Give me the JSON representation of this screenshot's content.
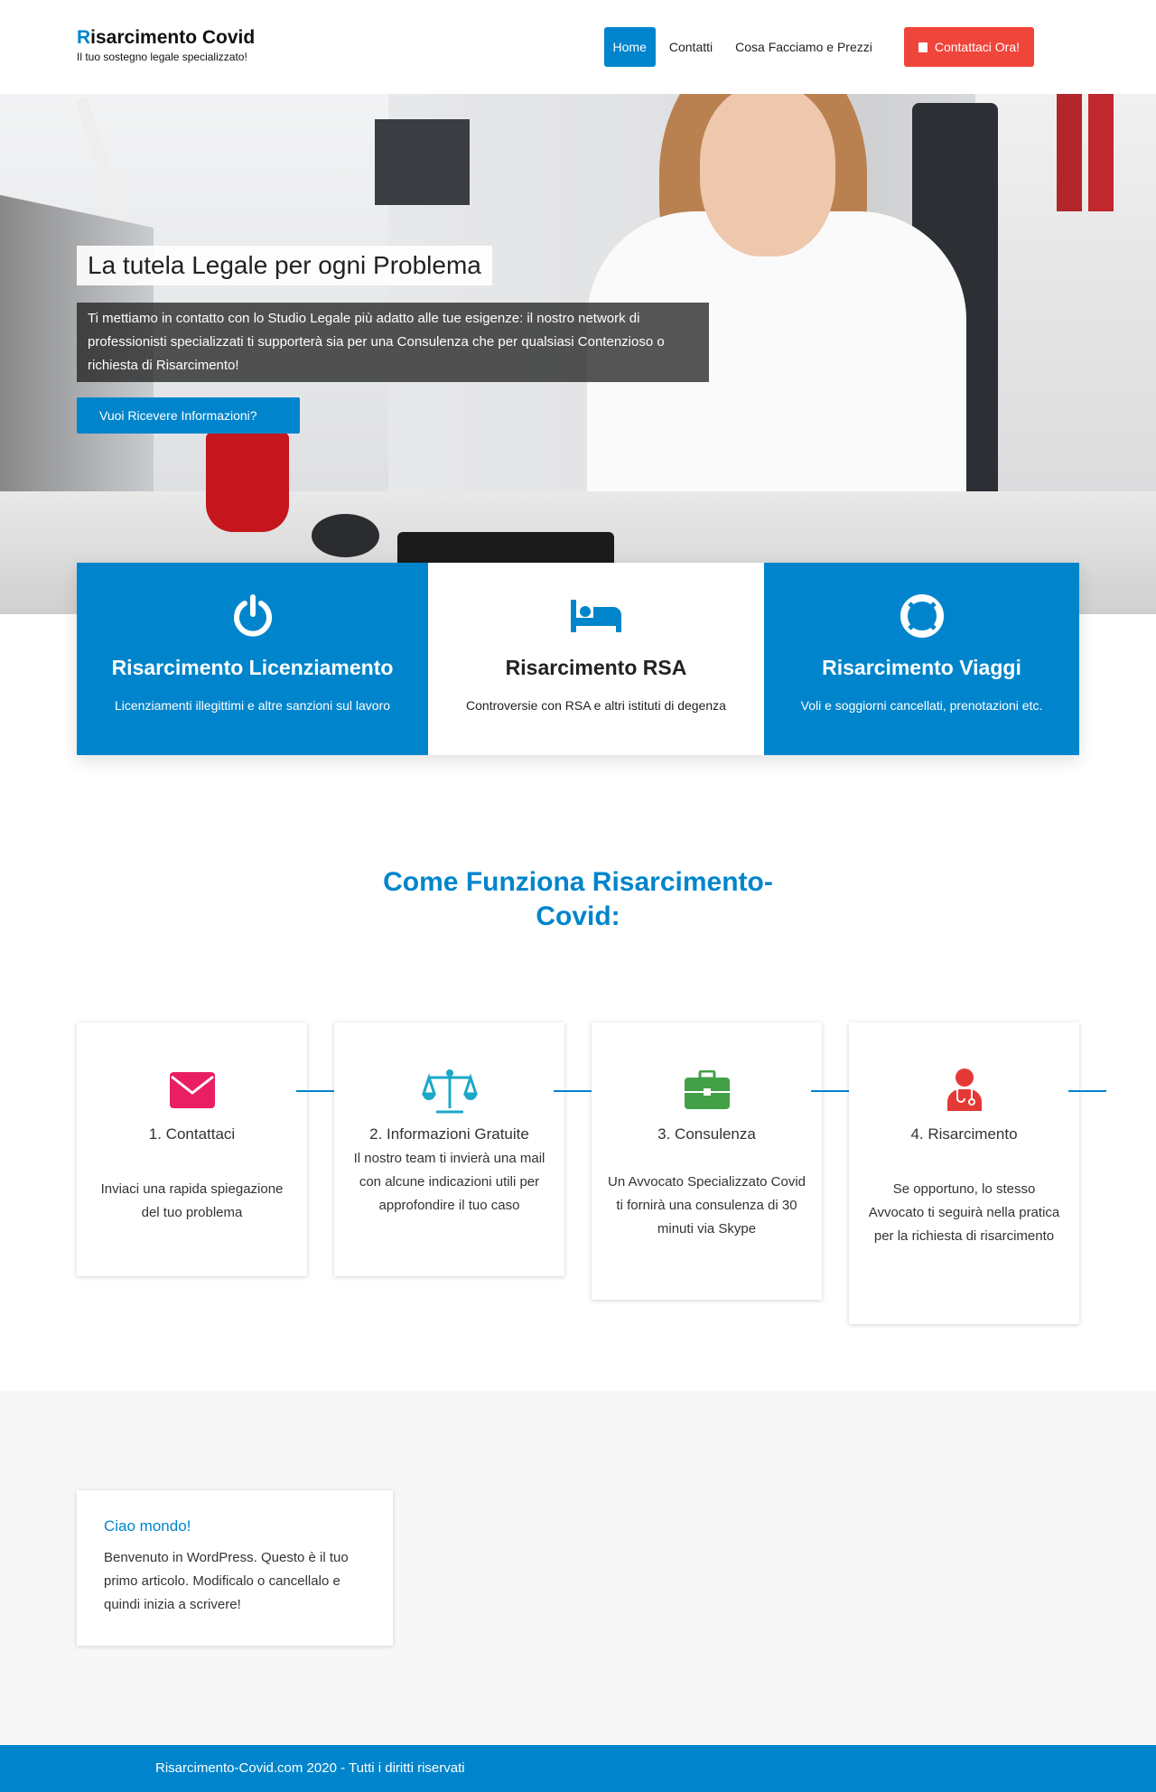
{
  "site": {
    "title_first": "R",
    "title_rest": "isarcimento Covid",
    "tagline": "Il tuo sostegno legale specializzato!"
  },
  "nav": {
    "items": [
      {
        "label": "Home",
        "active": true
      },
      {
        "label": "Contatti",
        "active": false
      },
      {
        "label": "Cosa Facciamo e Prezzi",
        "active": false
      }
    ],
    "cta_label": "Contattaci Ora!",
    "cta_icon": "book-icon"
  },
  "hero": {
    "title": "La tutela Legale per ogni Problema",
    "text": "Ti mettiamo in contatto con lo Studio Legale più adatto alle tue esigenze: il nostro network di professionisti specializzati ti supporterà sia per una Consulenza che per qualsiasi Contenzioso o richiesta di Risarcimento!",
    "button_label": "Vuoi Ricevere Informazioni?"
  },
  "features": [
    {
      "icon": "power-icon",
      "title": "Risarcimento Licenziamento",
      "desc": "Licenziamenti illegittimi e altre sanzioni sul lavoro"
    },
    {
      "icon": "bed-icon",
      "title": "Risarcimento RSA",
      "desc": "Controversie con RSA e altri istituti di degenza"
    },
    {
      "icon": "life-ring-icon",
      "title": "Risarcimento Viaggi",
      "desc": "Voli e soggiorni cancellati, prenotazioni etc."
    }
  ],
  "how": {
    "title": "Come Funziona Risarcimento-Covid:"
  },
  "steps": [
    {
      "icon": "envelope-icon",
      "icon_color": "#e91e63",
      "title": "1. Contattaci",
      "desc": "Inviaci una rapida spiegazione del tuo problema"
    },
    {
      "icon": "scale-icon",
      "icon_color": "#1ba8c9",
      "title": "2. Informazioni Gratuite",
      "desc": "Il nostro team ti invierà una mail con alcune indicazioni utili per approfondire il tuo caso"
    },
    {
      "icon": "briefcase-icon",
      "icon_color": "#43a047",
      "title": "3. Consulenza",
      "desc": "Un Avvocato Specializzato Covid ti fornirà una consulenza di 30 minuti via Skype"
    },
    {
      "icon": "doctor-icon",
      "icon_color": "#e53935",
      "title": "4. Risarcimento",
      "desc": "Se opportuno, lo stesso Avvocato ti seguirà nella pratica per la richiesta di risarcimento"
    }
  ],
  "post": {
    "title": "Ciao mondo!",
    "text": "Benvenuto in WordPress. Questo è il tuo primo articolo. Modificalo o cancellalo e quindi inizia a scrivere!"
  },
  "footer": {
    "text": "Risarcimento-Covid.com 2020 - Tutti i diritti riservati"
  },
  "colors": {
    "accent": "#0085cc",
    "cta": "#f0453a"
  }
}
